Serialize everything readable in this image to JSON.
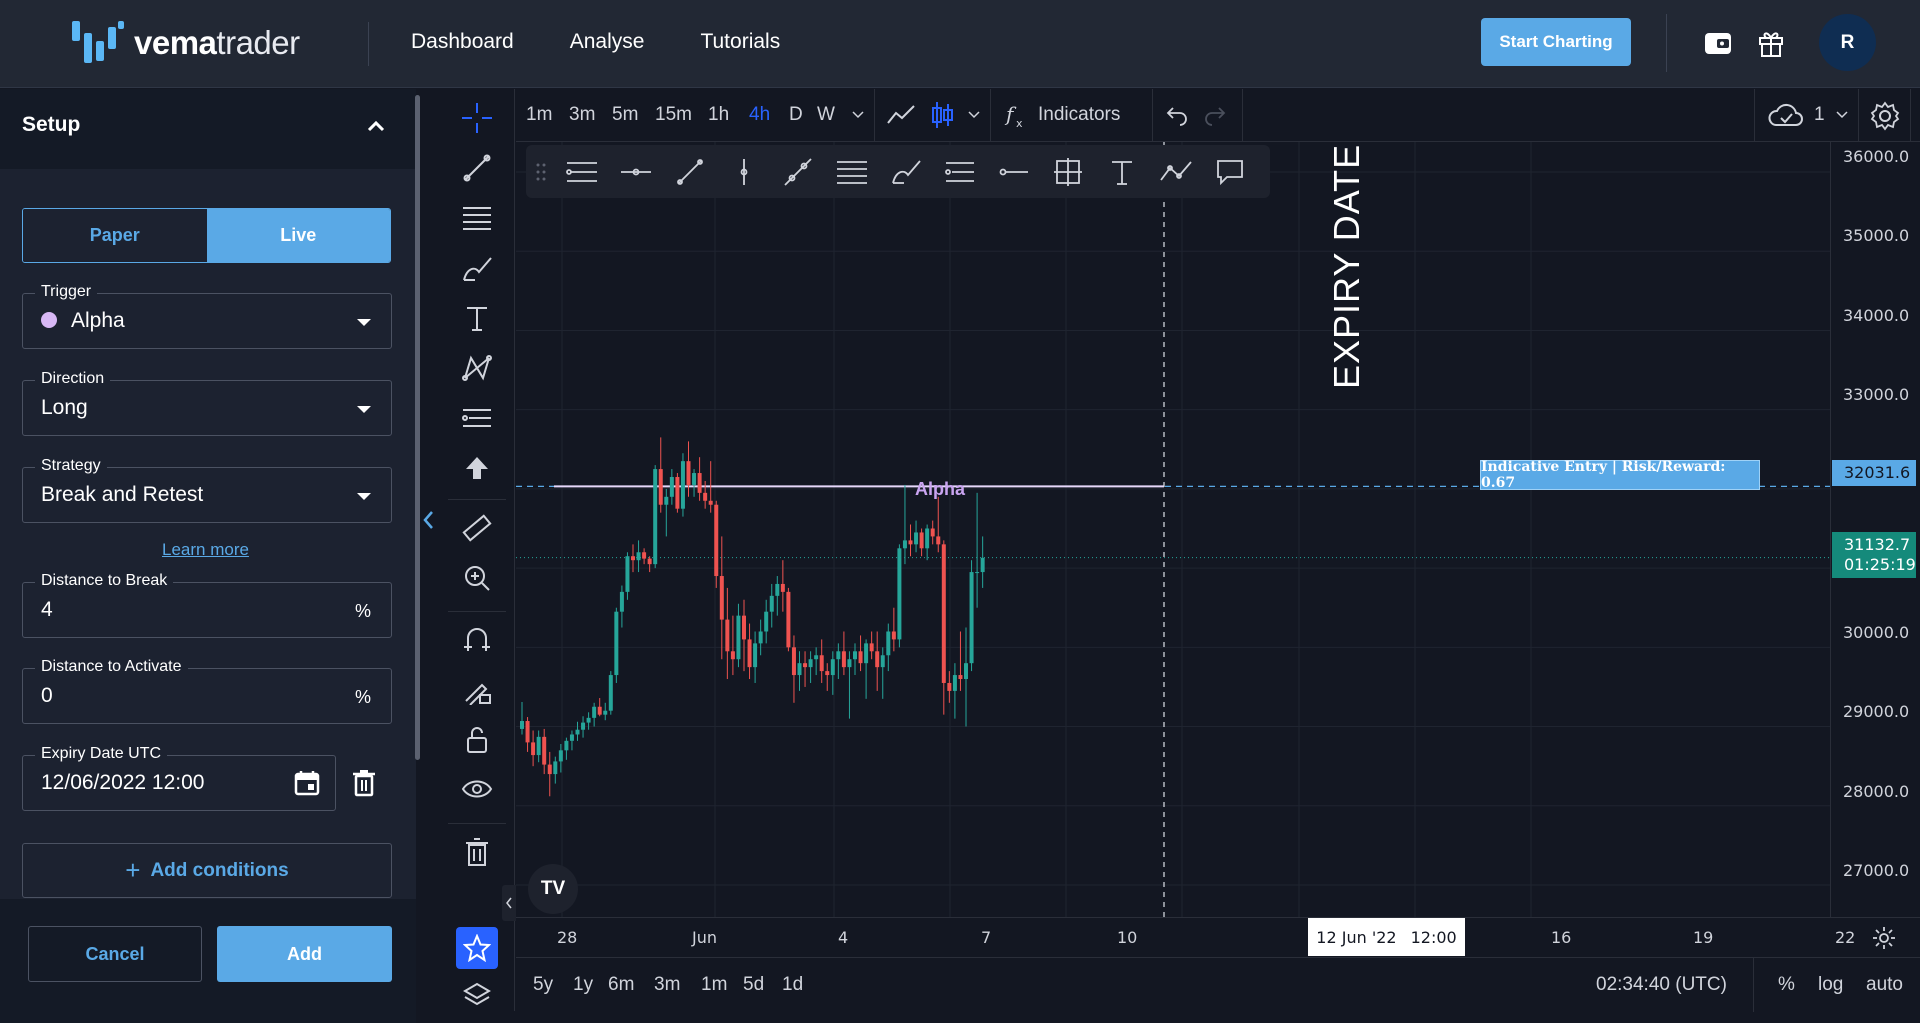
{
  "header": {
    "brand_bold": "vema",
    "brand_light": "trader",
    "nav": [
      "Dashboard",
      "Analyse",
      "Tutorials"
    ],
    "start_button": "Start Charting",
    "avatar_initial": "R",
    "accent_color": "#5aa9e6"
  },
  "setup": {
    "title": "Setup",
    "mode_options": [
      "Paper",
      "Live"
    ],
    "mode_selected": "Live",
    "trigger_label": "Trigger",
    "trigger_value": "Alpha",
    "trigger_color": "#d8b8f5",
    "direction_label": "Direction",
    "direction_value": "Long",
    "strategy_label": "Strategy",
    "strategy_value": "Break and Retest",
    "learn_more": "Learn more",
    "distance_break_label": "Distance to Break",
    "distance_break_value": "4",
    "distance_break_unit": "%",
    "distance_activate_label": "Distance to Activate",
    "distance_activate_value": "0",
    "distance_activate_unit": "%",
    "expiry_label": "Expiry Date UTC",
    "expiry_value": "12/06/2022 12:00",
    "add_conditions": "Add conditions",
    "cancel": "Cancel",
    "add": "Add"
  },
  "chart_toolbar": {
    "timeframes": [
      "1m",
      "3m",
      "5m",
      "15m",
      "1h",
      "4h",
      "D",
      "W"
    ],
    "active_timeframe": "4h",
    "indicators": "Indicators",
    "cloud_count": "1"
  },
  "chart": {
    "expiry_annotation": "EXPIRY DATE",
    "alpha_label": "Alpha",
    "entry_label": "Indicative Entry | Risk/Reward: 0.67",
    "entry_price": "32031.6",
    "last_price": "31132.7",
    "countdown": "01:25:19",
    "price_ticks": [
      "36000.0",
      "35000.0",
      "34000.0",
      "33000.0",
      "30000.0",
      "29000.0",
      "28000.0",
      "27000.0"
    ],
    "time_ticks": [
      "28",
      "Jun",
      "4",
      "7",
      "10",
      "16",
      "19",
      "22"
    ],
    "crosshair_date": "12 Jun '22",
    "crosshair_time": "12:00",
    "ranges": [
      "5y",
      "1y",
      "6m",
      "3m",
      "1m",
      "5d",
      "1d"
    ],
    "clock": "02:34:40 (UTC)",
    "scale_opts": [
      "%",
      "log",
      "auto"
    ],
    "up_color": "#26a69a",
    "down_color": "#ef5350"
  },
  "chart_data": {
    "type": "candlestick",
    "title": "",
    "ylim": [
      26500,
      36300
    ],
    "levels": {
      "alpha": 32031.6,
      "last": 31132.7
    },
    "candles": [
      [
        28970,
        29310,
        28900,
        29070
      ],
      [
        29070,
        29120,
        28680,
        28800
      ],
      [
        28800,
        28950,
        28500,
        28640
      ],
      [
        28640,
        28950,
        28550,
        28870
      ],
      [
        28870,
        28970,
        28400,
        28520
      ],
      [
        28520,
        28680,
        28120,
        28400
      ],
      [
        28400,
        28620,
        28280,
        28560
      ],
      [
        28560,
        28780,
        28420,
        28700
      ],
      [
        28700,
        28860,
        28580,
        28820
      ],
      [
        28820,
        28950,
        28700,
        28900
      ],
      [
        28900,
        29060,
        28820,
        28960
      ],
      [
        28960,
        29130,
        28860,
        29050
      ],
      [
        29050,
        29180,
        28960,
        29110
      ],
      [
        29110,
        29300,
        29000,
        29250
      ],
      [
        29250,
        29360,
        29130,
        29150
      ],
      [
        29150,
        29300,
        29080,
        29200
      ],
      [
        29200,
        29700,
        29150,
        29650
      ],
      [
        29650,
        30500,
        29550,
        30450
      ],
      [
        30450,
        30780,
        30250,
        30700
      ],
      [
        30700,
        31200,
        30600,
        31150
      ],
      [
        31150,
        31300,
        30950,
        31100
      ],
      [
        31100,
        31350,
        30950,
        31200
      ],
      [
        31200,
        31250,
        31050,
        31120
      ],
      [
        31120,
        31150,
        30950,
        31050
      ],
      [
        31050,
        32300,
        31000,
        32250
      ],
      [
        32250,
        32650,
        31700,
        31800
      ],
      [
        31800,
        32000,
        31400,
        31900
      ],
      [
        31900,
        32250,
        31800,
        32150
      ],
      [
        32150,
        32200,
        31700,
        31750
      ],
      [
        31750,
        32450,
        31650,
        32350
      ],
      [
        32350,
        32600,
        31900,
        32050
      ],
      [
        32050,
        32250,
        31900,
        32200
      ],
      [
        32200,
        32400,
        31850,
        31950
      ],
      [
        31950,
        32100,
        31750,
        31850
      ],
      [
        31850,
        32350,
        31700,
        31800
      ],
      [
        31800,
        31850,
        30750,
        30900
      ],
      [
        30900,
        31400,
        29850,
        30350
      ],
      [
        30350,
        30750,
        29600,
        29950
      ],
      [
        29950,
        30400,
        29650,
        29850
      ],
      [
        29850,
        30550,
        29750,
        30400
      ],
      [
        30400,
        30600,
        29700,
        30100
      ],
      [
        30100,
        30300,
        29600,
        29750
      ],
      [
        29750,
        30200,
        29550,
        30050
      ],
      [
        30050,
        30350,
        29900,
        30200
      ],
      [
        30200,
        30600,
        30050,
        30450
      ],
      [
        30450,
        30800,
        30250,
        30650
      ],
      [
        30650,
        30900,
        30400,
        30800
      ],
      [
        30800,
        31100,
        30450,
        30700
      ],
      [
        30700,
        30750,
        29950,
        30000
      ],
      [
        30000,
        30150,
        29300,
        29650
      ],
      [
        29650,
        29950,
        29450,
        29800
      ],
      [
        29800,
        29950,
        29500,
        29750
      ],
      [
        29750,
        29950,
        29550,
        29850
      ],
      [
        29850,
        30000,
        29650,
        29900
      ],
      [
        29900,
        30100,
        29550,
        29700
      ],
      [
        29700,
        29800,
        29450,
        29650
      ],
      [
        29650,
        29950,
        29400,
        29850
      ],
      [
        29850,
        30050,
        29600,
        29950
      ],
      [
        29950,
        30200,
        29650,
        29750
      ],
      [
        29750,
        29950,
        29100,
        29850
      ],
      [
        29850,
        30050,
        29650,
        29950
      ],
      [
        29950,
        30150,
        29700,
        29800
      ],
      [
        29800,
        30100,
        29350,
        30050
      ],
      [
        30050,
        30200,
        29850,
        29950
      ],
      [
        29950,
        30200,
        29450,
        29750
      ],
      [
        29750,
        30000,
        29350,
        29900
      ],
      [
        29900,
        30300,
        29700,
        30200
      ],
      [
        30200,
        30500,
        29950,
        30100
      ],
      [
        30100,
        31300,
        30000,
        31250
      ],
      [
        31250,
        32050,
        31050,
        31350
      ],
      [
        31350,
        31550,
        31150,
        31300
      ],
      [
        31300,
        31600,
        31200,
        31450
      ],
      [
        31450,
        31500,
        31150,
        31250
      ],
      [
        31250,
        31550,
        31100,
        31500
      ],
      [
        31500,
        31600,
        31300,
        31400
      ],
      [
        31400,
        31900,
        31200,
        31300
      ],
      [
        31300,
        31350,
        29150,
        29550
      ],
      [
        29550,
        29700,
        29300,
        29450
      ],
      [
        29450,
        29800,
        29100,
        29650
      ],
      [
        29650,
        30200,
        29450,
        29600
      ],
      [
        29600,
        30250,
        29000,
        29800
      ],
      [
        29800,
        31100,
        29700,
        30950
      ],
      [
        30950,
        31950,
        30500,
        30950
      ],
      [
        30950,
        31400,
        30750,
        31130
      ]
    ]
  }
}
